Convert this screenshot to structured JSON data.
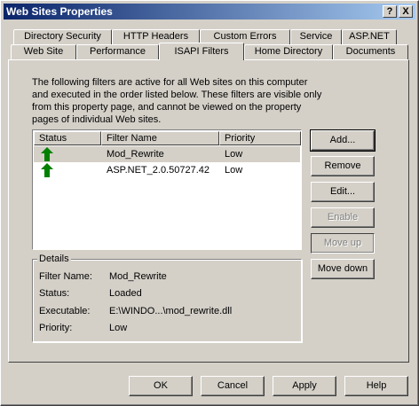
{
  "window": {
    "title": "Web Sites Properties",
    "help_btn": "?",
    "close_btn": "X"
  },
  "tabs_row1": [
    "Directory Security",
    "HTTP Headers",
    "Custom Errors",
    "Service",
    "ASP.NET"
  ],
  "tabs_row2": [
    "Web Site",
    "Performance",
    "ISAPI Filters",
    "Home Directory",
    "Documents"
  ],
  "active_tab": "ISAPI Filters",
  "description": "The following filters are active for all Web sites on this computer and executed in the order listed below. These filters are visible only from this property page, and cannot be viewed on the property pages of individual Web sites.",
  "list": {
    "headers": {
      "status": "Status",
      "filter_name": "Filter Name",
      "priority": "Priority"
    },
    "rows": [
      {
        "name": "Mod_Rewrite",
        "priority": "Low",
        "status_icon": "green-up-arrow-icon",
        "selected": true
      },
      {
        "name": "ASP.NET_2.0.50727.42",
        "priority": "Low",
        "status_icon": "green-up-arrow-icon",
        "selected": false
      }
    ]
  },
  "side_buttons": {
    "add": "Add...",
    "remove": "Remove",
    "edit": "Edit...",
    "enable": "Enable",
    "move_up": "Move up",
    "move_down": "Move down"
  },
  "details": {
    "title": "Details",
    "filter_name_label": "Filter Name:",
    "filter_name_value": "Mod_Rewrite",
    "status_label": "Status:",
    "status_value": "Loaded",
    "executable_label": "Executable:",
    "executable_value": "E:\\WINDO...\\mod_rewrite.dll",
    "priority_label": "Priority:",
    "priority_value": "Low"
  },
  "bottom_buttons": {
    "ok": "OK",
    "cancel": "Cancel",
    "apply": "Apply",
    "help": "Help"
  },
  "colors": {
    "titlebar_start": "#0a246a",
    "titlebar_end": "#a6caf0",
    "arrow_green": "#008000",
    "face": "#d4d0c8"
  }
}
